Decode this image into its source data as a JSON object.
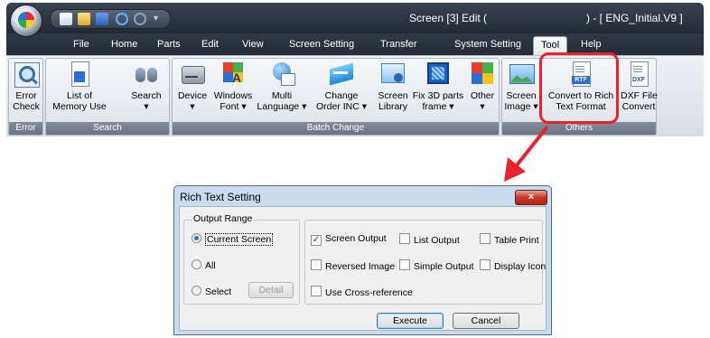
{
  "window": {
    "title": "Screen [3] Edit (",
    "title_suffix": ") - [ ENG_Initial.V9 ]"
  },
  "menu_tabs": [
    {
      "label": "File"
    },
    {
      "label": "Home"
    },
    {
      "label": "Parts"
    },
    {
      "label": "Edit"
    },
    {
      "label": "View"
    },
    {
      "label": "Screen Setting"
    },
    {
      "label": "Transfer"
    },
    {
      "label": "System Setting"
    },
    {
      "label": "Tool",
      "active": true
    },
    {
      "label": "Help"
    }
  ],
  "ribbon": {
    "groups": [
      {
        "label": "Error"
      },
      {
        "label": "Search"
      },
      {
        "label": "Batch Change"
      },
      {
        "label": "Others"
      }
    ],
    "buttons": {
      "error_check": {
        "line1": "Error",
        "line2": "Check",
        "icon": "magnifier-icon"
      },
      "list_of_memory_use": {
        "line1": "List of",
        "line2": "Memory Use",
        "icon": "document-icon"
      },
      "search": {
        "line1": "Search",
        "line2": "▾",
        "icon": "binoculars-icon"
      },
      "device": {
        "line1": "Device",
        "line2": "▾",
        "icon": "device-icon"
      },
      "windows_font": {
        "line1": "Windows",
        "line2": "Font ▾",
        "icon": "font-icon"
      },
      "multi_language": {
        "line1": "Multi",
        "line2": "Language ▾",
        "icon": "globe-icon"
      },
      "change_order_inc": {
        "line1": "Change",
        "line2": "Order INC ▾",
        "icon": "order-icon"
      },
      "screen_library": {
        "line1": "Screen",
        "line2": "Library",
        "icon": "library-icon"
      },
      "fix_3d_parts_frame": {
        "line1": "Fix 3D parts",
        "line2": "frame ▾",
        "icon": "frame-icon"
      },
      "other": {
        "line1": "Other",
        "line2": "▾",
        "icon": "other-icon"
      },
      "screen_image": {
        "line1": "Screen",
        "line2": "Image ▾",
        "icon": "image-icon"
      },
      "convert_to_rtf": {
        "line1": "Convert to Rich",
        "line2": "Text Format",
        "icon": "rtf-file-icon",
        "badge": "RTF"
      },
      "dxf_file_convert": {
        "line1": "DXF File",
        "line2": "Convert",
        "icon": "dxf-file-icon",
        "badge": "DXF"
      }
    }
  },
  "dialog": {
    "title": "Rich Text Setting",
    "close_label": "×",
    "output_range": {
      "legend": "Output Range",
      "options": [
        "Current Screen",
        "All",
        "Select"
      ],
      "selected": "Current Screen",
      "detail_label": "Detail"
    },
    "checkboxes": [
      {
        "label": "Screen Output",
        "checked": true
      },
      {
        "label": "List Output",
        "checked": false
      },
      {
        "label": "Table Print",
        "checked": false
      },
      {
        "label": "Reversed Image",
        "checked": false
      },
      {
        "label": "Simple Output",
        "checked": false
      },
      {
        "label": "Display Icon",
        "checked": false
      },
      {
        "label": "Use Cross-reference",
        "checked": false
      }
    ],
    "execute_label": "Execute",
    "cancel_label": "Cancel"
  },
  "colors": {
    "highlight": "#e8232b",
    "ribbon_dark": "#2b3340",
    "dialog_frame": "#c9dbee"
  }
}
